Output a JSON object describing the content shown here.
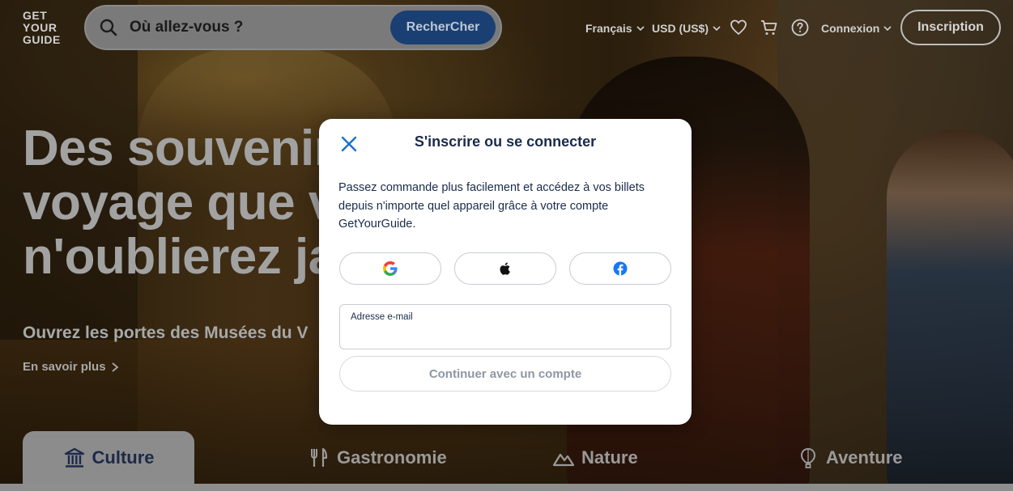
{
  "brand": {
    "logo_lines": [
      "GET",
      "YOUR",
      "GUIDE"
    ]
  },
  "search": {
    "placeholder": "Où allez-vous ?",
    "button_label": "RecherCher"
  },
  "header": {
    "language": "Français",
    "currency": "USD (US$)",
    "login": "Connexion",
    "signup": "Inscription",
    "icons": [
      "heart-icon",
      "cart-icon",
      "help-icon"
    ]
  },
  "hero": {
    "title_lines": [
      "Des souvenirs",
      "voyage que v",
      "n'oublierez ja"
    ],
    "subtitle": "Ouvrez les portes des Musées du V",
    "more_link": "En savoir plus"
  },
  "categories": {
    "active": "Culture",
    "items": [
      "Gastronomie",
      "Nature",
      "Aventure"
    ]
  },
  "modal": {
    "title": "S'inscrire ou se connecter",
    "description": "Passez commande plus facilement et accédez à vos billets depuis n'importe quel appareil grâce à votre compte GetYourGuide.",
    "social_buttons": [
      "google-icon",
      "apple-icon",
      "facebook-icon"
    ],
    "email_label": "Adresse e-mail",
    "email_value": "",
    "continue_label": "Continuer avec un compte"
  },
  "colors": {
    "brand_blue": "#1a2b49",
    "search_button": "#1a3f73",
    "google_blue": "#4285F4",
    "google_red": "#EA4335",
    "google_yellow": "#FBBC05",
    "google_green": "#34A853",
    "facebook_blue": "#1877F2"
  }
}
